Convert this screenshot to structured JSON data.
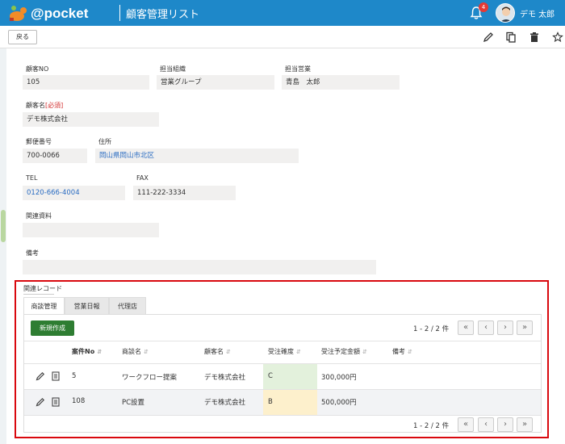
{
  "header": {
    "logo_text": "@pocket",
    "title": "顧客管理リスト",
    "notification_count": "4",
    "user_name": "デモ 太郎",
    "bg_color": "#1e88c9"
  },
  "toolbar": {
    "back_label": "戻る",
    "icons": [
      "pencil-icon",
      "copy-icon",
      "trash-icon",
      "star-icon"
    ]
  },
  "form": {
    "customer_no": {
      "label": "顧客NO",
      "value": "105"
    },
    "org": {
      "label": "担当組織",
      "value": "営業グループ"
    },
    "sales_rep": {
      "label": "担当営業",
      "value": "青島　太郎"
    },
    "customer_name": {
      "label": "顧客名",
      "required": "[必須]",
      "value": "デモ株式会社"
    },
    "postal": {
      "label": "郵便番号",
      "value": "700-0066"
    },
    "address": {
      "label": "住所",
      "value": "岡山県岡山市北区"
    },
    "tel": {
      "label": "TEL",
      "value": "0120-666-4004"
    },
    "fax": {
      "label": "FAX",
      "value": "111-222-3334"
    },
    "docs": {
      "label": "関連資料",
      "value": ""
    },
    "notes": {
      "label": "備考",
      "value": ""
    }
  },
  "related": {
    "title": "関連レコード",
    "tabs": [
      "商談管理",
      "営業日報",
      "代理店"
    ],
    "active_tab": 0,
    "new_label": "新規作成",
    "pagination": "1 - 2 / 2 件",
    "pager_buttons": [
      "«",
      "‹",
      "›",
      "»"
    ],
    "columns": [
      "案件No",
      "商談名",
      "顧客名",
      "受注確度",
      "受注予定金額",
      "備考"
    ],
    "rows": [
      {
        "no": "5",
        "name": "ワークフロー提案",
        "customer": "デモ株式会社",
        "confidence": "C",
        "confidence_color": "#e3f1dc",
        "amount": "300,000円",
        "note": ""
      },
      {
        "no": "108",
        "name": "PC設置",
        "customer": "デモ株式会社",
        "confidence": "B",
        "confidence_color": "#fdf0cc",
        "amount": "500,000円",
        "note": ""
      }
    ],
    "highlight_color": "#d9080e"
  }
}
